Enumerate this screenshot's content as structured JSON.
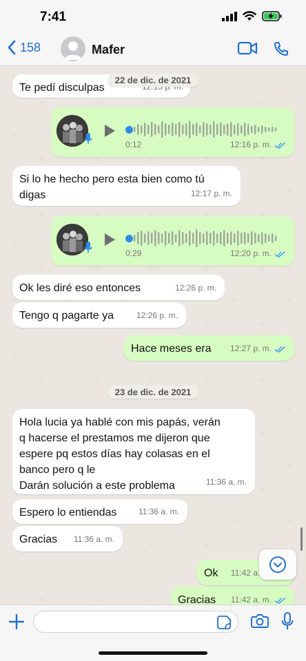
{
  "status_bar": {
    "time": "7:41"
  },
  "header": {
    "back_count": "158",
    "contact_name": "Mafer"
  },
  "date_separators": [
    "22 de dic. de 2021",
    "23 de dic. de 2021"
  ],
  "messages": [
    {
      "type": "text",
      "dir": "in",
      "text": "Te pedí disculpas",
      "time": "12:15 p. m."
    },
    {
      "type": "voice",
      "dir": "out",
      "duration": "0:12",
      "time": "12:16 p. m.",
      "read": true
    },
    {
      "type": "text",
      "dir": "in",
      "text": "Si lo he hecho pero esta bien como tú\ndigas",
      "time": "12:17 p. m."
    },
    {
      "type": "voice",
      "dir": "out",
      "duration": "0:29",
      "time": "12:20 p. m.",
      "read": true
    },
    {
      "type": "text",
      "dir": "in",
      "text": "Ok les diré eso entonces",
      "time": "12:26 p. m."
    },
    {
      "type": "text",
      "dir": "in",
      "text": "Tengo q pagarte ya",
      "time": "12:26 p. m."
    },
    {
      "type": "text",
      "dir": "out",
      "text": "Hace meses era",
      "time": "12:27 p. m.",
      "read": true
    },
    {
      "type": "text",
      "dir": "in",
      "text": "Hola lucia ya hablé con mis papás, verán\nq hacerse el prestamos me dijeron que\nespere pq estos días hay colasas en el\nbanco pero q le\nDarán solución a este problema",
      "time": "11:36 a. m."
    },
    {
      "type": "text",
      "dir": "in",
      "text": "Espero lo entiendas",
      "time": "11:36 a. m."
    },
    {
      "type": "text",
      "dir": "in",
      "text": "Gracias",
      "time": "11:36 a. m."
    },
    {
      "type": "text",
      "dir": "out",
      "text": "Ok",
      "time": "11:42 a. m.",
      "read": true
    },
    {
      "type": "text",
      "dir": "out",
      "text": "Gracias",
      "time": "11:42 a. m.",
      "read": true
    }
  ],
  "input": {
    "placeholder": ""
  },
  "colors": {
    "accent": "#1d6fd6",
    "outgoing_bubble": "#d7fcc2",
    "incoming_bubble": "#ffffff",
    "chat_bg": "#ebe6df",
    "read_tick": "#3497f9"
  },
  "icons": [
    "back-chevron-icon",
    "video-call-icon",
    "phone-icon",
    "play-icon",
    "mic-icon",
    "read-check-icon",
    "scroll-down-icon",
    "plus-icon",
    "sticker-icon",
    "camera-icon",
    "microphone-icon"
  ]
}
